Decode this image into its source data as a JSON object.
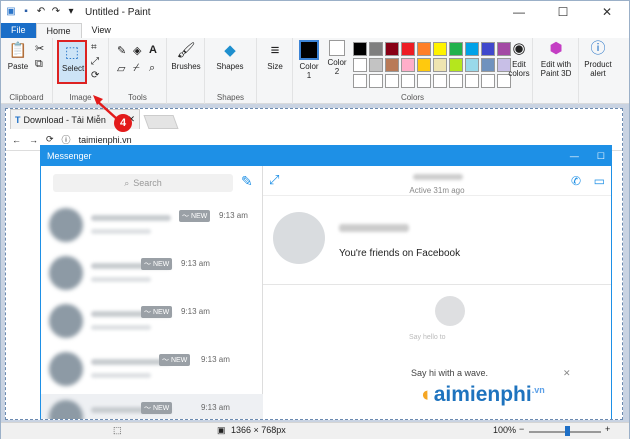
{
  "window": {
    "title": "Untitled - Paint"
  },
  "tabs": {
    "file": "File",
    "home": "Home",
    "view": "View"
  },
  "ribbon": {
    "clipboard": {
      "label": "Clipboard",
      "paste": "Paste"
    },
    "image": {
      "label": "Image",
      "select": "Select"
    },
    "tools": {
      "label": "Tools"
    },
    "brushes": "Brushes",
    "shapes": {
      "label": "Shapes",
      "button": "Shapes"
    },
    "size": "Size",
    "colors": {
      "label": "Colors",
      "color1": "Color\n1",
      "color2": "Color\n2",
      "edit": "Edit\ncolors",
      "palette": [
        "#000000",
        "#7f7f7f",
        "#880015",
        "#ed1c24",
        "#ff7f27",
        "#fff200",
        "#22b14c",
        "#00a2e8",
        "#3f48cc",
        "#a349a4",
        "#ffffff",
        "#c3c3c3",
        "#b97a57",
        "#ffaec9",
        "#ffc90e",
        "#efe4b0",
        "#b5e61d",
        "#99d9ea",
        "#7092be",
        "#c8bfe7",
        "#ffffff",
        "#ffffff",
        "#ffffff",
        "#ffffff",
        "#ffffff",
        "#ffffff",
        "#ffffff",
        "#ffffff",
        "#ffffff",
        "#ffffff"
      ]
    },
    "paint3d": "Edit with\nPaint 3D",
    "product": "Product\nalert"
  },
  "annotation": {
    "step": "4"
  },
  "browser": {
    "tab_title": "Download - Tải Miễn",
    "url": "taimienphi.vn"
  },
  "messenger": {
    "title": "Messenger",
    "search_placeholder": "Search",
    "active": "Active 31m ago",
    "friends": "You're friends on Facebook",
    "hello": "Say hello to",
    "wave": "Say hi with a wave.",
    "rows": [
      {
        "badge": "NEW",
        "time": "9:13 am"
      },
      {
        "badge": "NEW",
        "time": "9:13 am"
      },
      {
        "badge": "NEW",
        "time": "9:13 am"
      },
      {
        "badge": "NEW",
        "time": "9:13 am"
      },
      {
        "badge": "NEW",
        "time": "9:13 am"
      }
    ]
  },
  "status": {
    "dimensions": "1366 × 768px",
    "zoom": "100%"
  },
  "watermark": {
    "text": "aimienphi",
    "suffix": ".vn"
  }
}
